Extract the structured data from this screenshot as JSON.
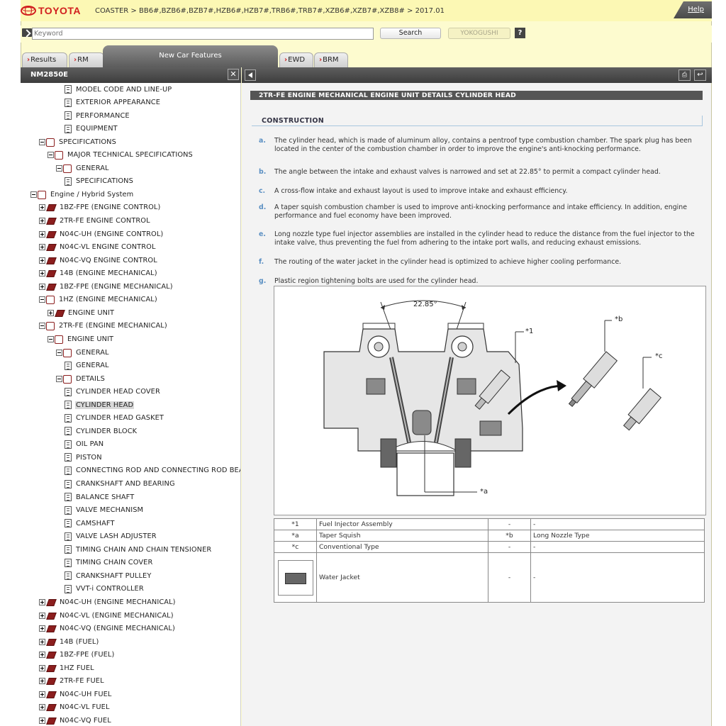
{
  "header": {
    "brand": "TOYOTA",
    "breadcrumb": "COASTER > BB6#,BZB6#,BZB7#,HZB6#,HZB7#,TRB6#,TRB7#,XZB6#,XZB7#,XZB8# > 2017.01",
    "help_label": "Help"
  },
  "search": {
    "placeholder": "Keyword",
    "value": "",
    "search_label": "Search",
    "yokogushi_label": "YOKOGUSHI",
    "help_symbol": "?"
  },
  "tabs": [
    {
      "label": "Results",
      "active": false
    },
    {
      "label": "RM",
      "active": false
    },
    {
      "label": "New Car Features",
      "active": true
    },
    {
      "label": "EWD",
      "active": false
    },
    {
      "label": "BRM",
      "active": false
    }
  ],
  "left_panel": {
    "doc_id": "NM2850E",
    "close_symbol": "✕"
  },
  "tree": [
    {
      "label": "MODEL CODE AND LINE-UP",
      "depth": 4,
      "icon": "doc",
      "toggle": "none"
    },
    {
      "label": "EXTERIOR APPEARANCE",
      "depth": 4,
      "icon": "doc",
      "toggle": "none"
    },
    {
      "label": "PERFORMANCE",
      "depth": 4,
      "icon": "doc",
      "toggle": "none"
    },
    {
      "label": "EQUIPMENT",
      "depth": 4,
      "icon": "doc",
      "toggle": "none"
    },
    {
      "label": "SPECIFICATIONS",
      "depth": 1,
      "icon": "book",
      "toggle": "minus"
    },
    {
      "label": "MAJOR TECHNICAL SPECIFICATIONS",
      "depth": 2,
      "icon": "book",
      "toggle": "minus"
    },
    {
      "label": "GENERAL",
      "depth": 3,
      "icon": "book",
      "toggle": "minus"
    },
    {
      "label": "SPECIFICATIONS",
      "depth": 4,
      "icon": "doc",
      "toggle": "none"
    },
    {
      "label": "Engine / Hybrid System",
      "depth": 0,
      "icon": "book",
      "toggle": "minus"
    },
    {
      "label": "1BZ-FPE (ENGINE CONTROL)",
      "depth": 1,
      "icon": "closed",
      "toggle": "plus"
    },
    {
      "label": "2TR-FE ENGINE CONTROL",
      "depth": 1,
      "icon": "closed",
      "toggle": "plus"
    },
    {
      "label": "N04C-UH (ENGINE CONTROL)",
      "depth": 1,
      "icon": "closed",
      "toggle": "plus"
    },
    {
      "label": "N04C-VL ENGINE CONTROL",
      "depth": 1,
      "icon": "closed",
      "toggle": "plus"
    },
    {
      "label": "N04C-VQ ENGINE CONTROL",
      "depth": 1,
      "icon": "closed",
      "toggle": "plus"
    },
    {
      "label": "14B (ENGINE MECHANICAL)",
      "depth": 1,
      "icon": "closed",
      "toggle": "plus"
    },
    {
      "label": "1BZ-FPE (ENGINE MECHANICAL)",
      "depth": 1,
      "icon": "closed",
      "toggle": "plus"
    },
    {
      "label": "1HZ (ENGINE MECHANICAL)",
      "depth": 1,
      "icon": "book",
      "toggle": "minus"
    },
    {
      "label": "ENGINE UNIT",
      "depth": 2,
      "icon": "closed",
      "toggle": "plus"
    },
    {
      "label": "2TR-FE (ENGINE MECHANICAL)",
      "depth": 1,
      "icon": "book",
      "toggle": "minus"
    },
    {
      "label": "ENGINE UNIT",
      "depth": 2,
      "icon": "book",
      "toggle": "minus"
    },
    {
      "label": "GENERAL",
      "depth": 3,
      "icon": "book",
      "toggle": "minus"
    },
    {
      "label": "GENERAL",
      "depth": 4,
      "icon": "doc",
      "toggle": "none"
    },
    {
      "label": "DETAILS",
      "depth": 3,
      "icon": "book",
      "toggle": "minus"
    },
    {
      "label": "CYLINDER HEAD COVER",
      "depth": 4,
      "icon": "doc",
      "toggle": "none"
    },
    {
      "label": "CYLINDER HEAD",
      "depth": 4,
      "icon": "doc",
      "toggle": "none",
      "selected": true
    },
    {
      "label": "CYLINDER HEAD GASKET",
      "depth": 4,
      "icon": "doc",
      "toggle": "none"
    },
    {
      "label": "CYLINDER BLOCK",
      "depth": 4,
      "icon": "doc",
      "toggle": "none"
    },
    {
      "label": "OIL PAN",
      "depth": 4,
      "icon": "doc",
      "toggle": "none"
    },
    {
      "label": "PISTON",
      "depth": 4,
      "icon": "doc",
      "toggle": "none"
    },
    {
      "label": "CONNECTING ROD AND CONNECTING ROD BEA",
      "depth": 4,
      "icon": "doc",
      "toggle": "none"
    },
    {
      "label": "CRANKSHAFT AND BEARING",
      "depth": 4,
      "icon": "doc",
      "toggle": "none"
    },
    {
      "label": "BALANCE SHAFT",
      "depth": 4,
      "icon": "doc",
      "toggle": "none"
    },
    {
      "label": "VALVE MECHANISM",
      "depth": 4,
      "icon": "doc",
      "toggle": "none"
    },
    {
      "label": "CAMSHAFT",
      "depth": 4,
      "icon": "doc",
      "toggle": "none"
    },
    {
      "label": "VALVE LASH ADJUSTER",
      "depth": 4,
      "icon": "doc",
      "toggle": "none"
    },
    {
      "label": "TIMING CHAIN AND CHAIN TENSIONER",
      "depth": 4,
      "icon": "doc",
      "toggle": "none"
    },
    {
      "label": "TIMING CHAIN COVER",
      "depth": 4,
      "icon": "doc",
      "toggle": "none"
    },
    {
      "label": "CRANKSHAFT PULLEY",
      "depth": 4,
      "icon": "doc",
      "toggle": "none"
    },
    {
      "label": "VVT-i CONTROLLER",
      "depth": 4,
      "icon": "doc",
      "toggle": "none"
    },
    {
      "label": "N04C-UH (ENGINE MECHANICAL)",
      "depth": 1,
      "icon": "closed",
      "toggle": "plus"
    },
    {
      "label": "N04C-VL (ENGINE MECHANICAL)",
      "depth": 1,
      "icon": "closed",
      "toggle": "plus"
    },
    {
      "label": "N04C-VQ (ENGINE MECHANICAL)",
      "depth": 1,
      "icon": "closed",
      "toggle": "plus"
    },
    {
      "label": "14B (FUEL)",
      "depth": 1,
      "icon": "closed",
      "toggle": "plus"
    },
    {
      "label": "1BZ-FPE (FUEL)",
      "depth": 1,
      "icon": "closed",
      "toggle": "plus"
    },
    {
      "label": "1HZ FUEL",
      "depth": 1,
      "icon": "closed",
      "toggle": "plus"
    },
    {
      "label": "2TR-FE FUEL",
      "depth": 1,
      "icon": "closed",
      "toggle": "plus"
    },
    {
      "label": "N04C-UH FUEL",
      "depth": 1,
      "icon": "closed",
      "toggle": "plus"
    },
    {
      "label": "N04C-VL FUEL",
      "depth": 1,
      "icon": "closed",
      "toggle": "plus"
    },
    {
      "label": "N04C-VQ FUEL",
      "depth": 1,
      "icon": "closed",
      "toggle": "plus"
    }
  ],
  "content": {
    "page_title": "2TR-FE ENGINE MECHANICAL  ENGINE UNIT  DETAILS  CYLINDER HEAD",
    "section_title": "CONSTRUCTION",
    "paragraphs": [
      {
        "marker": "a.",
        "text": "The cylinder head, which is made of aluminum alloy, contains a pentroof type combustion chamber. The spark plug has been located in the center of the combustion chamber in order to improve the engine's anti-knocking performance."
      },
      {
        "marker": "b.",
        "text": "The angle between the intake and exhaust valves is narrowed and set at 22.85° to permit a compact cylinder head."
      },
      {
        "marker": "c.",
        "text": "A cross-flow intake and exhaust layout is used to improve intake and exhaust efficiency."
      },
      {
        "marker": "d.",
        "text": "A taper squish combustion chamber is used to improve anti-knocking performance and intake efficiency. In addition, engine performance and fuel economy have been improved."
      },
      {
        "marker": "e.",
        "text": "Long nozzle type fuel injector assemblies are installed in the cylinder head to reduce the distance from the fuel injector to the intake valve, thus preventing the fuel from adhering to the intake port walls, and reducing exhaust emissions."
      },
      {
        "marker": "f.",
        "text": "The routing of the water jacket in the cylinder head is optimized to achieve higher cooling performance."
      },
      {
        "marker": "g.",
        "text": "Plastic region tightening bolts are used for the cylinder head."
      }
    ],
    "diagram": {
      "angle_label": "22.85°",
      "callout_1": "*1",
      "callout_a": "*a",
      "callout_b": "*b",
      "callout_c": "*c"
    },
    "legend": [
      {
        "k1": "*1",
        "v1": "Fuel Injector Assembly",
        "k2": "-",
        "v2": "-"
      },
      {
        "k1": "*a",
        "v1": "Taper Squish",
        "k2": "*b",
        "v2": "Long Nozzle Type"
      },
      {
        "k1": "*c",
        "v1": "Conventional Type",
        "k2": "-",
        "v2": "-"
      },
      {
        "k1": "",
        "v1": "Water Jacket",
        "k2": "-",
        "v2": "-"
      }
    ]
  },
  "colors": {
    "brand_red": "#d11f1f",
    "header_yellow": "#fcf8b4",
    "marker_blue": "#5a8fc2"
  }
}
